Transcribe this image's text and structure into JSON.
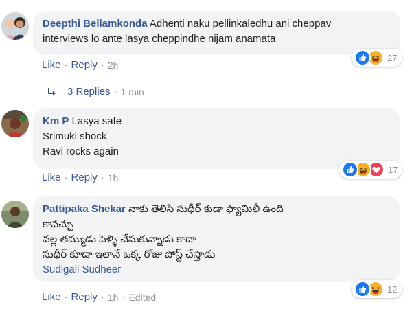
{
  "comments": [
    {
      "author": "Deepthi Bellamkonda",
      "lines": [
        "Adhenti naku pellinkaledhu ani cheppav",
        "interviews lo ante lasya cheppindhe nijam anamata"
      ],
      "actions": {
        "like": "Like",
        "reply": "Reply",
        "time": "2h"
      },
      "reactions": {
        "icons": [
          "like-icon",
          "haha-icon"
        ],
        "count": "27"
      },
      "replies": {
        "label": "3 Replies",
        "time": "1 min"
      }
    },
    {
      "author": "Km P",
      "lines": [
        "Lasya safe",
        "Srimuki shock",
        "Ravi rocks again"
      ],
      "actions": {
        "like": "Like",
        "reply": "Reply",
        "time": "1h"
      },
      "reactions": {
        "icons": [
          "like-icon",
          "haha-icon",
          "love-icon"
        ],
        "count": "17"
      }
    },
    {
      "author": "Pattipaka Shekar",
      "lines": [
        "నాకు తెలిసి సుధీర్ కుడా ఫ్యామిలీ ఉంది",
        "కావచ్చు",
        "వల్ల తమ్ముడు పెళ్ళి చేసుకున్నాడు కాదా",
        "సుధీర్ కూడా ఇలానే ఒక్క రోజు పోస్ట్ చేస్తాడు"
      ],
      "tag": "Sudigali Sudheer",
      "actions": {
        "like": "Like",
        "reply": "Reply",
        "time": "1h",
        "edited": "Edited"
      },
      "reactions": {
        "icons": [
          "like-icon",
          "haha-icon"
        ],
        "count": "12"
      }
    }
  ],
  "colors": {
    "link": "#385898",
    "bubble": "#f2f3f5",
    "meta": "#90949c",
    "like": "#1877f2",
    "haha": "#f7b125",
    "love": "#f33e58"
  }
}
